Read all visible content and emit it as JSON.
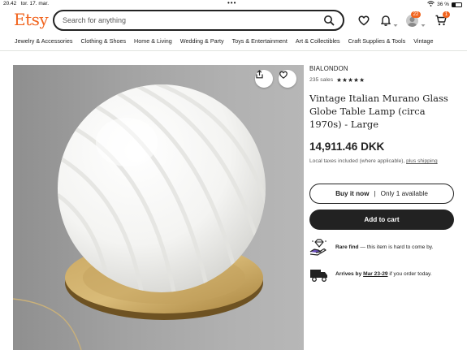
{
  "status_bar": {
    "time": "20.42",
    "date": "tor. 17. mar.",
    "battery": "36 %"
  },
  "header": {
    "logo": "Etsy",
    "search_placeholder": "Search for anything",
    "notifications_badge": "22",
    "cart_badge": "1",
    "brand_color": "#f1641e"
  },
  "categories": [
    "Jewelry & Accessories",
    "Clothing & Shoes",
    "Home & Living",
    "Wedding & Party",
    "Toys & Entertainment",
    "Art & Collectibles",
    "Craft Supplies & Tools",
    "Vintage"
  ],
  "product": {
    "shop_name": "BIALONDON",
    "sales": "235 sales",
    "rating_stars": "★★★★★",
    "title": "Vintage Italian Murano Glass Globe Table Lamp (circa 1970s) - Large",
    "price": "14,911.46 DKK",
    "tax_note": "Local taxes included (where applicable),",
    "tax_link": "plus shipping",
    "buy_now_label": "Buy it now",
    "availability": "Only 1 available",
    "add_to_cart_label": "Add to cart",
    "rare_find_title": "Rare find",
    "rare_find_text": "— this item is hard to come by.",
    "arrival_prefix": "Arrives by",
    "arrival_date": "Mar 23-29",
    "arrival_suffix": "if you order today."
  },
  "icons": {
    "share": "share-icon",
    "favorite": "heart-icon",
    "search": "search-icon",
    "bell": "bell-icon",
    "cart": "cart-icon",
    "rare": "diamond-hand-icon",
    "truck": "truck-icon"
  }
}
